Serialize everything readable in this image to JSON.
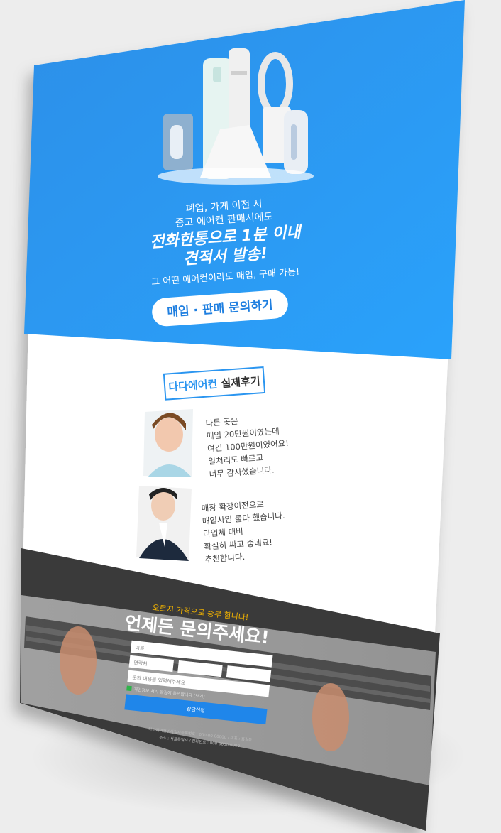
{
  "hero": {
    "line1": "폐업, 가게 이전 시",
    "line2": "중고 에어컨 판매시에도",
    "headline1": "전화한통으로 1분 이내",
    "headline2": "견적서 발송!",
    "sub": "그 어떤 에어컨이라도 매입, 구매 가능!",
    "cta_label": "매입 · 판매 문의하기"
  },
  "reviews": {
    "title_brand": "다다에어컨",
    "title_rest": " 실제후기",
    "items": [
      {
        "lines": [
          "다른 곳은",
          "매입 20만원이였는데",
          "여긴 100만원이였어요!",
          "일처리도 빠르고",
          "너무 감사했습니다."
        ]
      },
      {
        "lines": [
          "매장 확장이전으로",
          "매입사입 둘다 했습니다.",
          "타업체 대비",
          "확실히 싸고 좋네요!",
          "추천합니다."
        ]
      }
    ]
  },
  "contact": {
    "eyebrow": "오로지 가격으로 승부 합니다!",
    "headline": "언제든 문의주세요!",
    "name_placeholder": "이름",
    "phone_placeholder": "연락처",
    "message_placeholder": "문의 내용을 입력해주세요",
    "consent_label": "개인정보 처리 방침에 동의합니다 [보기]",
    "submit_label": "상담신청",
    "footer_line1": "다다에어컨 / 사업자등록번호 : 000-00-00000 / 대표 : 홍길동",
    "footer_line2": "주소 : 서울특별시 / 전화번호 : 000-0000-0000"
  },
  "colors": {
    "brand_blue": "#2a95f0",
    "dark_band": "#3c3c3c",
    "accent_yellow": "#f3b400",
    "submit_blue": "#1f86ea"
  }
}
